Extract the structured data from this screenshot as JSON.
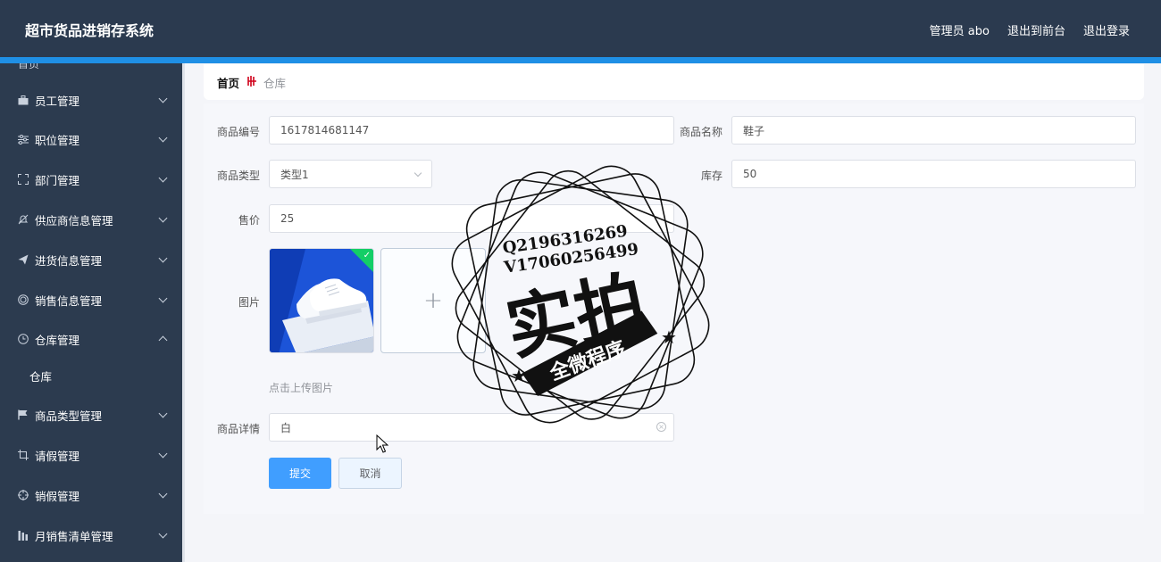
{
  "app": {
    "title": "超市货品进销存系统"
  },
  "header_nav": {
    "admin": "管理员 abo",
    "front": "退出到前台",
    "logout": "退出登录"
  },
  "sidebar": {
    "cut_item": "首页",
    "items": [
      {
        "label": "员工管理",
        "icon": "briefcase-icon"
      },
      {
        "label": "职位管理",
        "icon": "sliders-icon"
      },
      {
        "label": "部门管理",
        "icon": "crop-frame-icon"
      },
      {
        "label": "供应商信息管理",
        "icon": "bell-off-icon"
      },
      {
        "label": "进货信息管理",
        "icon": "send-icon"
      },
      {
        "label": "销售信息管理",
        "icon": "target-ring-icon"
      },
      {
        "label": "仓库管理",
        "icon": "clock-icon"
      },
      {
        "label": "商品类型管理",
        "icon": "flag-icon"
      },
      {
        "label": "请假管理",
        "icon": "crop-icon"
      },
      {
        "label": "销假管理",
        "icon": "crosshair-icon"
      },
      {
        "label": "月销售清单管理",
        "icon": "bar-chart-icon"
      }
    ],
    "submenu": "仓库"
  },
  "breadcrumb": {
    "home": "首页",
    "current": "仓库"
  },
  "form": {
    "code_label": "商品编号",
    "code_value": "1617814681147",
    "name_label": "商品名称",
    "name_value": "鞋子",
    "type_label": "商品类型",
    "type_value": "类型1",
    "stock_label": "库存",
    "stock_value": "50",
    "price_label": "售价",
    "price_value": "25",
    "image_label": "图片",
    "upload_hint": "点击上传图片",
    "detail_label": "商品详情",
    "detail_value": "白",
    "submit": "提交",
    "cancel": "取消"
  },
  "stamp": {
    "line1": "Q2196316269",
    "line2": "V17060256499",
    "main": "实拍",
    "banner": "全微程序"
  }
}
